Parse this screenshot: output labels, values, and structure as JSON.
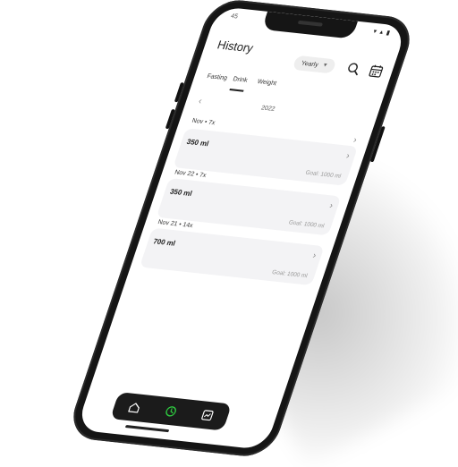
{
  "status": {
    "time": "45",
    "icons": "▾ ▴ ▮"
  },
  "header": {
    "title": "History",
    "period": "Yearly",
    "search_icon": "search-icon",
    "calendar_icon": "calendar-icon"
  },
  "tabs": [
    {
      "label": "Fasting"
    },
    {
      "label": "Drink",
      "selected": true
    },
    {
      "label": "Weight"
    }
  ],
  "year_nav": {
    "prev": "‹",
    "year": "2022"
  },
  "entries": [
    {
      "date": "Nov • 7x",
      "amount": "350 ml",
      "goal": "Goal: 1000 ml"
    },
    {
      "date": "Nov 22 • 7x",
      "amount": "350 ml",
      "goal": "Goal: 1000 ml"
    },
    {
      "date": "Nov 21 • 14x",
      "amount": "700 ml",
      "goal": "Goal: 1000 ml"
    }
  ],
  "chevron": "›",
  "nav": {
    "items": [
      "home-icon",
      "drink-gauge-icon",
      "chart-icon"
    ],
    "active": "drink-gauge-icon",
    "active_color": "#2ecc40"
  }
}
